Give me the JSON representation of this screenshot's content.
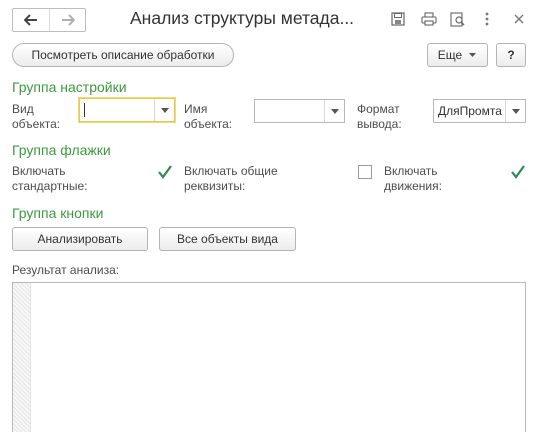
{
  "window": {
    "title": "Анализ структуры метада...",
    "icons": [
      "back-arrow-icon",
      "forward-arrow-icon",
      "save-icon",
      "print-icon",
      "preview-icon",
      "more-vertical-icon",
      "close-icon"
    ]
  },
  "toolbar": {
    "description_button": "Посмотреть описание обработки",
    "more_button": "Еще",
    "help_button": "?"
  },
  "settings_group": {
    "title": "Группа настройки",
    "object_kind_label": "Вид объекта:",
    "object_kind_value": "",
    "object_name_label": "Имя объекта:",
    "object_name_value": "",
    "output_format_label": "Формат вывода:",
    "output_format_value": "ДляПромта"
  },
  "flags_group": {
    "title": "Группа флажки",
    "include_standard_label": "Включать стандартные:",
    "include_standard_checked": true,
    "include_common_label": "Включать общие реквизиты:",
    "include_common_checked": false,
    "include_movements_label": "Включать движения:",
    "include_movements_checked": true
  },
  "buttons_group": {
    "title": "Группа кнопки",
    "analyze_button": "Анализировать",
    "all_objects_button": "Все объекты вида"
  },
  "result": {
    "label": "Результат анализа:",
    "value": ""
  },
  "colors": {
    "group_title": "#3c9b3c",
    "checkmark": "#2e8b57",
    "focus_border": "#e6c84a"
  }
}
